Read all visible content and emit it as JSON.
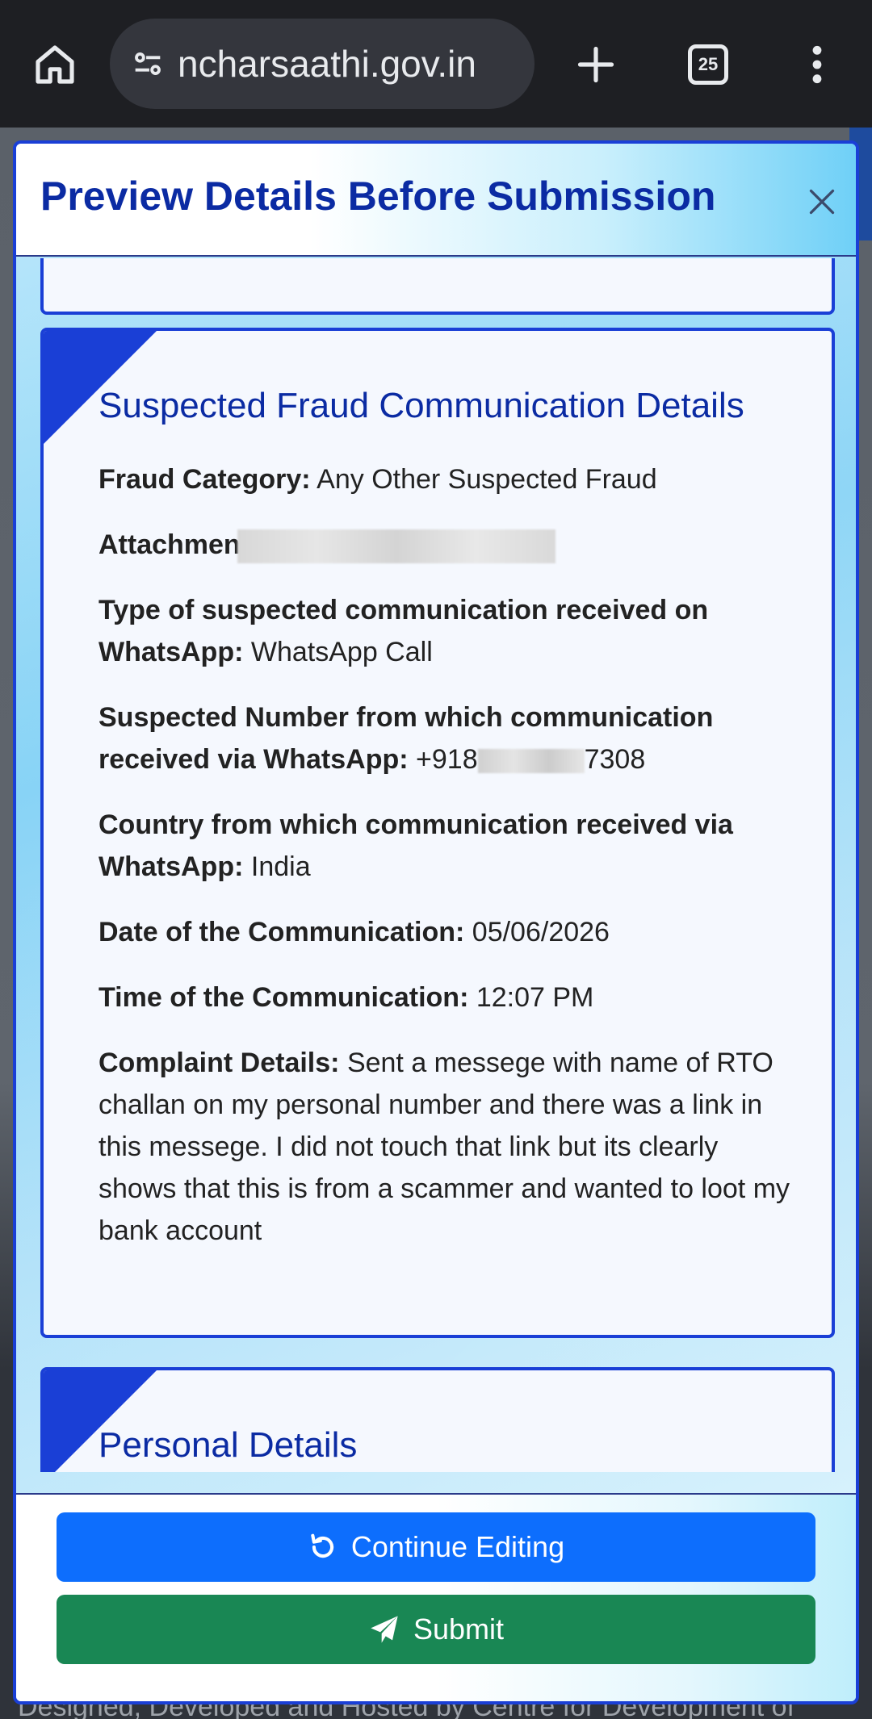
{
  "browser": {
    "url": "ncharsaathi.gov.in",
    "tab_count": "25"
  },
  "footer": {
    "text": "Designed, Developed and Hosted by Centre for Development of"
  },
  "modal": {
    "title": "Preview Details Before Submission",
    "fraud_section": {
      "title": "Suspected Fraud Communication Details",
      "fraud_category_label": "Fraud Category:",
      "fraud_category_value": "Any Other Suspected Fraud",
      "attachment_label": "Attachmen",
      "comm_type_label": "Type of suspected communication received on WhatsApp:",
      "comm_type_value": "WhatsApp Call",
      "number_label": "Suspected Number from which communication received via WhatsApp:",
      "number_prefix": "+918",
      "number_suffix": "7308",
      "country_label": "Country from which communication received via WhatsApp:",
      "country_value": "India",
      "date_label": "Date of the Communication:",
      "date_value": "05/06/2026",
      "time_label": "Time of the Communication:",
      "time_value": "12:07 PM",
      "complaint_label": "Complaint Details:",
      "complaint_value": "Sent a messege with name of RTO challan on my personal number and there was a link in this messege. I did not touch that link but its clearly shows that this is from a scammer and wanted to loot my bank account"
    },
    "personal_section": {
      "title": "Personal Details"
    },
    "buttons": {
      "continue_editing": "Continue Editing",
      "submit": "Submit"
    }
  },
  "colors": {
    "accent_blue": "#1a3fd6",
    "primary_button": "#0d6efd",
    "success_button": "#198754",
    "heading": "#0b2ba3"
  }
}
